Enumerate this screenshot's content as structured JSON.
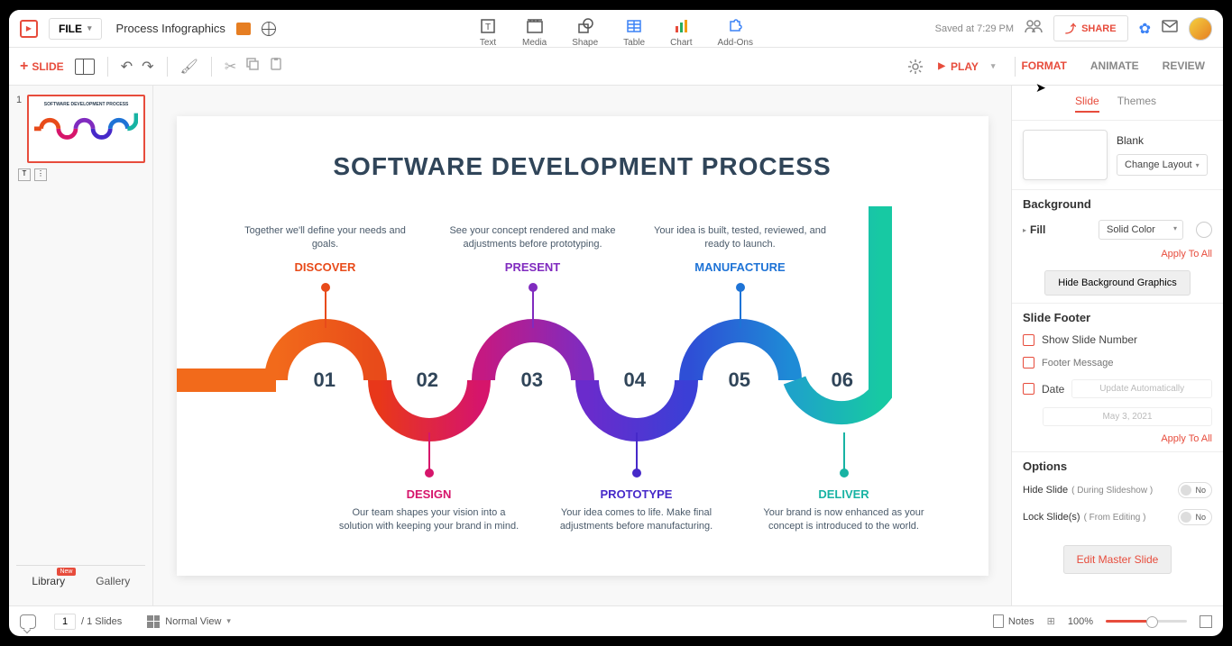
{
  "topbar": {
    "file_label": "FILE",
    "doc_title": "Process Infographics",
    "saved_text": "Saved at 7:29 PM",
    "share_label": "SHARE"
  },
  "tools": {
    "text": "Text",
    "media": "Media",
    "shape": "Shape",
    "table": "Table",
    "chart": "Chart",
    "addons": "Add-Ons"
  },
  "sec_toolbar": {
    "new_slide": "SLIDE",
    "play": "PLAY"
  },
  "right_tabs": {
    "format": "FORMAT",
    "animate": "ANIMATE",
    "review": "REVIEW"
  },
  "slide_panel": {
    "num": "1",
    "thumb_title": "SOFTWARE DEVELOPMENT PROCESS",
    "library_tab": "Library",
    "library_badge": "New",
    "gallery_tab": "Gallery"
  },
  "slide": {
    "title": "SOFTWARE DEVELOPMENT PROCESS",
    "steps": [
      {
        "num": "01",
        "name": "DISCOVER",
        "desc": "Together we'll define your needs and goals.",
        "color": "#e84b1a",
        "pos": "top"
      },
      {
        "num": "02",
        "name": "DESIGN",
        "desc": "Our team shapes your vision into a solution with keeping your brand in mind.",
        "color": "#d6156b",
        "pos": "bottom"
      },
      {
        "num": "03",
        "name": "PRESENT",
        "desc": "See your concept rendered and make adjustments before prototyping.",
        "color": "#802bbf",
        "pos": "top"
      },
      {
        "num": "04",
        "name": "PROTOTYPE",
        "desc": "Your idea comes to life. Make final adjustments before manufacturing.",
        "color": "#4629c9",
        "pos": "bottom"
      },
      {
        "num": "05",
        "name": "MANUFACTURE",
        "desc": "Your idea is built, tested, reviewed, and ready to launch.",
        "color": "#1e73d6",
        "pos": "top"
      },
      {
        "num": "06",
        "name": "DELIVER",
        "desc": "Your brand is now enhanced as your concept is introduced to the world.",
        "color": "#17b3a3",
        "pos": "bottom"
      }
    ]
  },
  "sidebar": {
    "subtab_slide": "Slide",
    "subtab_themes": "Themes",
    "layout_name": "Blank",
    "change_layout": "Change Layout",
    "bg_heading": "Background",
    "fill_label": "Fill",
    "fill_value": "Solid Color",
    "apply_all": "Apply To All",
    "hide_bg": "Hide Background Graphics",
    "footer_heading": "Slide Footer",
    "show_num": "Show Slide Number",
    "footer_msg_ph": "Footer Message",
    "date_label": "Date",
    "date_select": "Update Automatically",
    "date_value": "May 3, 2021",
    "options_heading": "Options",
    "hide_slide": "Hide Slide",
    "hide_slide_sub": "( During Slideshow )",
    "lock_slide": "Lock Slide(s)",
    "lock_slide_sub": "( From Editing )",
    "toggle_no": "No",
    "edit_master": "Edit Master Slide"
  },
  "status": {
    "page_current": "1",
    "page_total": "/ 1 Slides",
    "view_mode": "Normal View",
    "notes": "Notes",
    "zoom": "100%"
  }
}
